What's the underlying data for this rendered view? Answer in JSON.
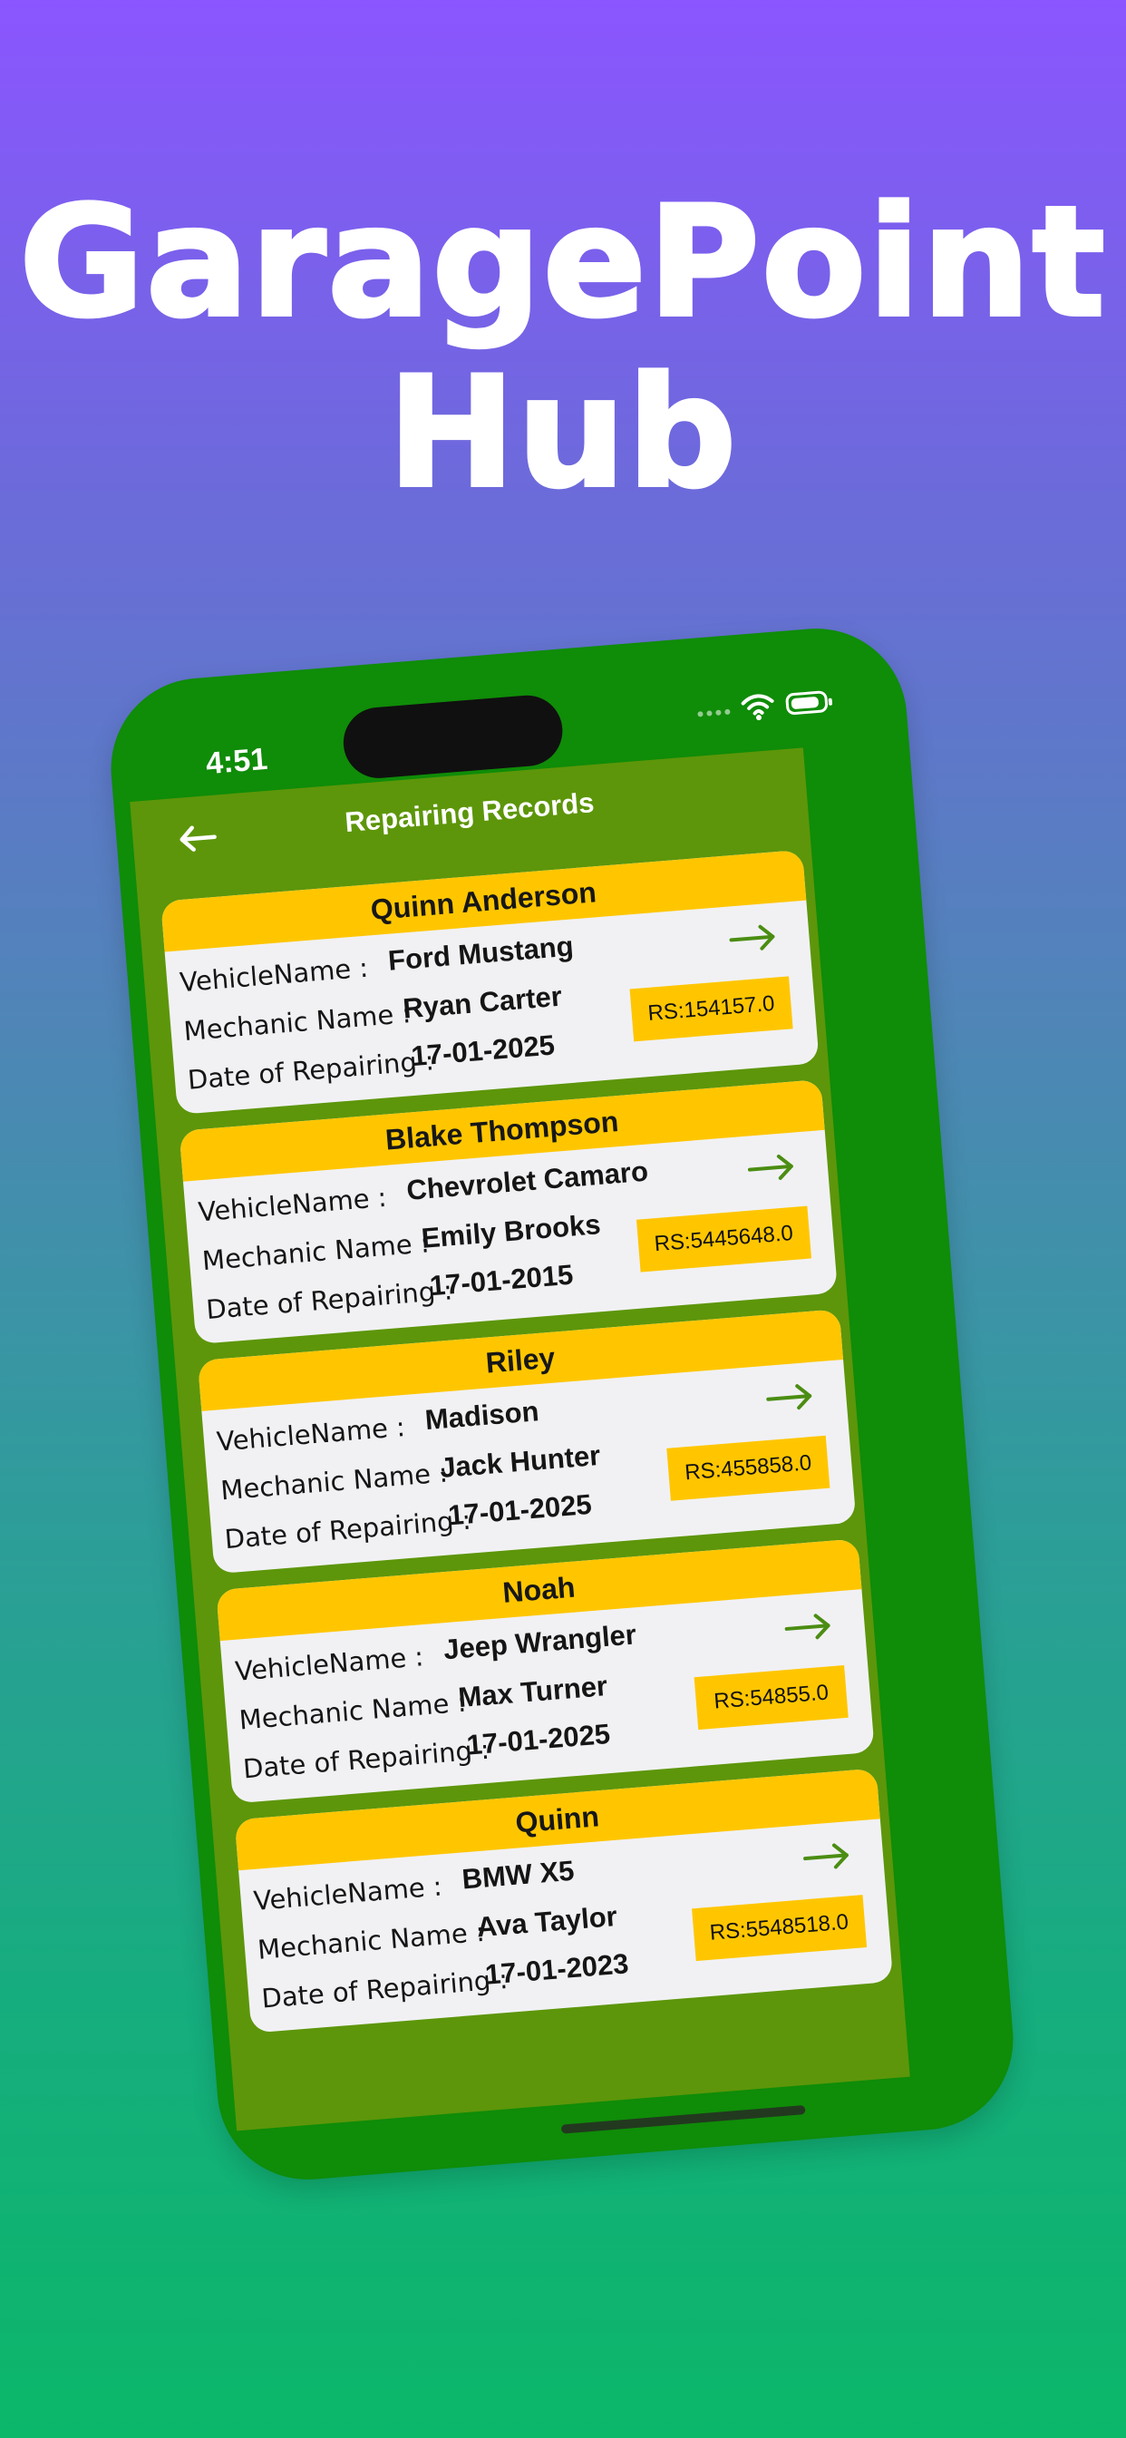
{
  "hero": {
    "title_line_1": "GaragePoint",
    "title_line_2": "Hub"
  },
  "device": {
    "time": "4:51",
    "icons": {
      "signal_dots": "signal-dots-icon",
      "wifi": "wifi-icon",
      "battery": "battery-icon"
    }
  },
  "screen": {
    "title": "Repairing Records",
    "back_icon": "back-arrow-icon",
    "open_icon": "right-arrow-icon"
  },
  "labels": {
    "vehicle": "VehicleName :",
    "mechanic": "Mechanic Name :",
    "date": "Date of Repairing :"
  },
  "records": [
    {
      "owner": "Quinn Anderson",
      "vehicle": "Ford Mustang",
      "mechanic": "Ryan Carter",
      "date": "17-01-2025",
      "amount": "RS:154157.0"
    },
    {
      "owner": "Blake Thompson",
      "vehicle": "Chevrolet Camaro",
      "mechanic": "Emily Brooks",
      "date": "17-01-2015",
      "amount": "RS:5445648.0"
    },
    {
      "owner": "Riley",
      "vehicle": "Madison",
      "mechanic": "Jack Hunter",
      "date": "17-01-2025",
      "amount": "RS:455858.0"
    },
    {
      "owner": "Noah",
      "vehicle": "Jeep Wrangler",
      "mechanic": "Max Turner",
      "date": "17-01-2025",
      "amount": "RS:54855.0"
    },
    {
      "owner": "Quinn",
      "vehicle": "BMW X5",
      "mechanic": "Ava Taylor",
      "date": "17-01-2023",
      "amount": "RS:5548518.0"
    }
  ],
  "colors": {
    "background_top": "#8b55ff",
    "background_bottom": "#0bb769",
    "phone_frame": "#0f8c08",
    "screen_background": "#5d960a",
    "card_header": "#ffc600",
    "card_body": "#f1f1f4",
    "arrow": "#4b8d12"
  }
}
